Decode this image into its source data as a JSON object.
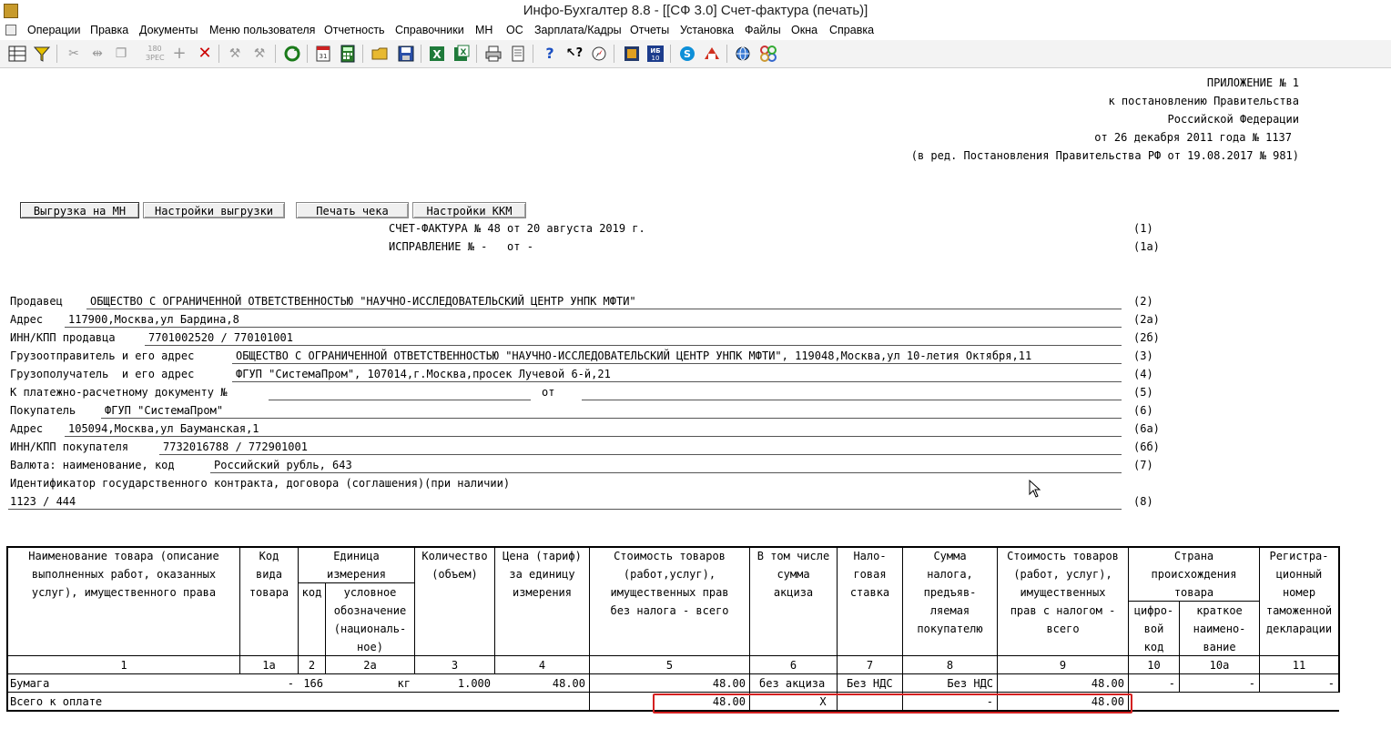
{
  "window": {
    "title": "Инфо-Бухгалтер 8.8 - [[СФ 3.0] Счет-фактура (печать)]"
  },
  "menu": [
    "Операции",
    "Правка",
    "Документы",
    "Меню пользователя",
    "Отчетность",
    "Справочники",
    "МН",
    "ОС",
    "Зарплата/Кадры",
    "Отчеты",
    "Установка",
    "Файлы",
    "Окна",
    "Справка"
  ],
  "toolbar": {
    "icons": [
      "grid-icon",
      "filter-icon",
      "cut-icon",
      "split-icon",
      "copy-icon",
      "stamp-icon",
      "add-icon",
      "delete-icon",
      "tool-icon",
      "tool2-icon",
      "refresh-icon",
      "calendar-icon",
      "calculator-icon",
      "open-folder-icon",
      "save-icon",
      "excel-icon",
      "excel-export-icon",
      "print-icon",
      "preview-icon",
      "help-icon",
      "context-help-icon",
      "compass-icon",
      "book-icon",
      "ib10-icon",
      "skype-icon",
      "remote-icon",
      "web-icon",
      "connect-icon"
    ],
    "ib10_text": "ИБ 10"
  },
  "header_note": {
    "l1": "ПРИЛОЖЕНИЕ № 1",
    "l2": "к постановлению Правительства",
    "l3": "Российской Федерации",
    "l4": "от 26 декабря 2011 года № 1137",
    "l5": "(в ред. Постановления Правительства РФ от 19.08.2017 № 981)"
  },
  "buttons": {
    "export_mn": "Выгрузка на МН",
    "export_settings": "Настройки выгрузки",
    "print_check": "Печать чека",
    "kkm_settings": "Настройки ККМ"
  },
  "invoice": {
    "title": "СЧЕТ-ФАКТУРА № 48 от 20 августа 2019 г.",
    "title_code": "(1)",
    "correction": "ИСПРАВЛЕНИЕ № -   от -",
    "correction_code": "(1а)"
  },
  "fields": {
    "seller_label": "Продавец",
    "seller": "ОБЩЕСТВО С ОГРАНИЧЕННОЙ ОТВЕТСТВЕННОСТЬЮ \"НАУЧНО-ИССЛЕДОВАТЕЛЬСКИЙ ЦЕНТР УНПК МФТИ\"",
    "seller_code": "(2)",
    "address_label": "Адрес",
    "address": "117900,Москва,ул Бардина,8",
    "address_code": "(2а)",
    "inn_label": "ИНН/КПП продавца",
    "inn": "7701002520 / 770101001",
    "inn_code": "(2б)",
    "shipper_label": "Грузоотправитель и его адрес",
    "shipper": "ОБЩЕСТВО С ОГРАНИЧЕННОЙ ОТВЕТСТВЕННОСТЬЮ \"НАУЧНО-ИССЛЕДОВАТЕЛЬСКИЙ ЦЕНТР УНПК МФТИ\", 119048,Москва,ул 10-летия Октября,11",
    "shipper_code": "(3)",
    "consignee_label": "Грузополучатель  и его адрес",
    "consignee": "ФГУП \"СистемаПром\", 107014,г.Москва,просек Лучевой 6-й,21",
    "consignee_code": "(4)",
    "paydoc_label": "К платежно-расчетному документу №",
    "paydoc_from": "от",
    "paydoc_code": "(5)",
    "buyer_label": "Покупатель",
    "buyer": "ФГУП \"СистемаПром\"",
    "buyer_code": "(6)",
    "buyer_address_label": "Адрес",
    "buyer_address": "105094,Москва,ул Бауманская,1",
    "buyer_address_code": "(6а)",
    "buyer_inn_label": "ИНН/КПП покупателя",
    "buyer_inn": "7732016788 / 772901001",
    "buyer_inn_code": "(6б)",
    "currency_label": "Валюта: наименование, код",
    "currency": "Российский рубль, 643",
    "currency_code": "(7)",
    "contract_label": "Идентификатор государственного контракта, договора (соглашения)(при наличии)",
    "contract": "1123 / 444",
    "contract_code": "(8)"
  },
  "table": {
    "h1": "Наименование товара (описание\nвыполненных работ, оказанных\nуслуг), имущественного права",
    "h1a": "Код\nвида\nтовара",
    "h2grp": "Единица\nизмерения",
    "h2": "код",
    "h2a": "условное\nобозначение\n(националь-\nное)",
    "h3": "Количество\n(объем)",
    "h4": "Цена (тариф)\nза единицу\nизмерения",
    "h5": "Стоимость товаров\n(работ,услуг),\nимущественных прав\nбез налога - всего",
    "h6": "В том числе\nсумма\nакциза",
    "h7": "Нало-\nговая\nставка",
    "h8": "Сумма\nналога,\nпредъяв-\nляемая\nпокупателю",
    "h9": "Стоимость товаров\n(работ, услуг),\nимущественных\nправ с налогом -\nвсего",
    "h10grp": "Страна\nпроисхождения\nтовара",
    "h10": "цифро-\nвой\nкод",
    "h10a": "краткое\nнаимено-\nвание",
    "h11": "Регистра-\nционный\nномер\nтаможенной\nдекларации",
    "nums": [
      "1",
      "1а",
      "2",
      "2а",
      "3",
      "4",
      "5",
      "6",
      "7",
      "8",
      "9",
      "10",
      "10а",
      "11"
    ],
    "row": {
      "name": "Бумага",
      "kind": "-",
      "code": "166",
      "unit": "кг",
      "qty": "1.000",
      "price": "48.00",
      "cost": "48.00",
      "excise": "без акциза",
      "rate": "Без НДС",
      "tax": "Без НДС",
      "total": "48.00",
      "country_code": "-",
      "country": "-",
      "decl": "-"
    },
    "total_row": {
      "label": "Всего к оплате",
      "cost": "48.00",
      "excise": "X",
      "tax": "-",
      "total": "48.00"
    }
  }
}
